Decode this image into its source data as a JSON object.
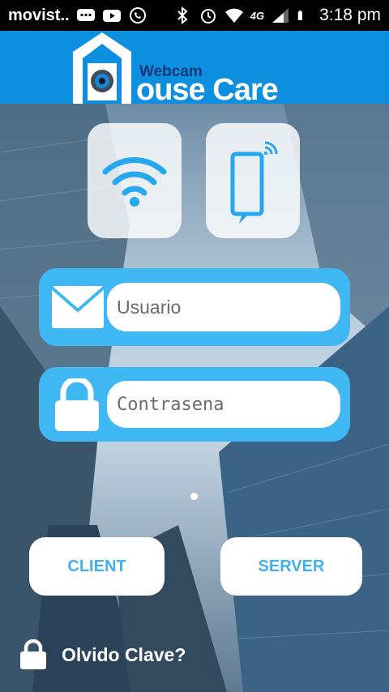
{
  "status_bar": {
    "carrier": "movist..",
    "time": "3:18 pm",
    "network_type": "4G",
    "icons": [
      "message-icon",
      "youtube-icon",
      "whatsapp-icon",
      "bluetooth-icon",
      "alarm-icon",
      "wifi-signal-icon",
      "cell-signal-icon",
      "battery-icon"
    ]
  },
  "header": {
    "logo_small_text": "Webcam",
    "logo_large_text": "ouse Care",
    "brand_color": "#0d8fe0"
  },
  "top_buttons": [
    {
      "name": "wifi-mode",
      "icon": "wifi-icon"
    },
    {
      "name": "phone-mode",
      "icon": "smartphone-signal-icon"
    }
  ],
  "login": {
    "username_placeholder": "Usuario",
    "password_placeholder": "Contrasena",
    "panel_color": "#3fb8f3"
  },
  "buttons": {
    "client_label": "CLIENT",
    "server_label": "SERVER"
  },
  "footer": {
    "forgot_label": "Olvido Clave?"
  }
}
